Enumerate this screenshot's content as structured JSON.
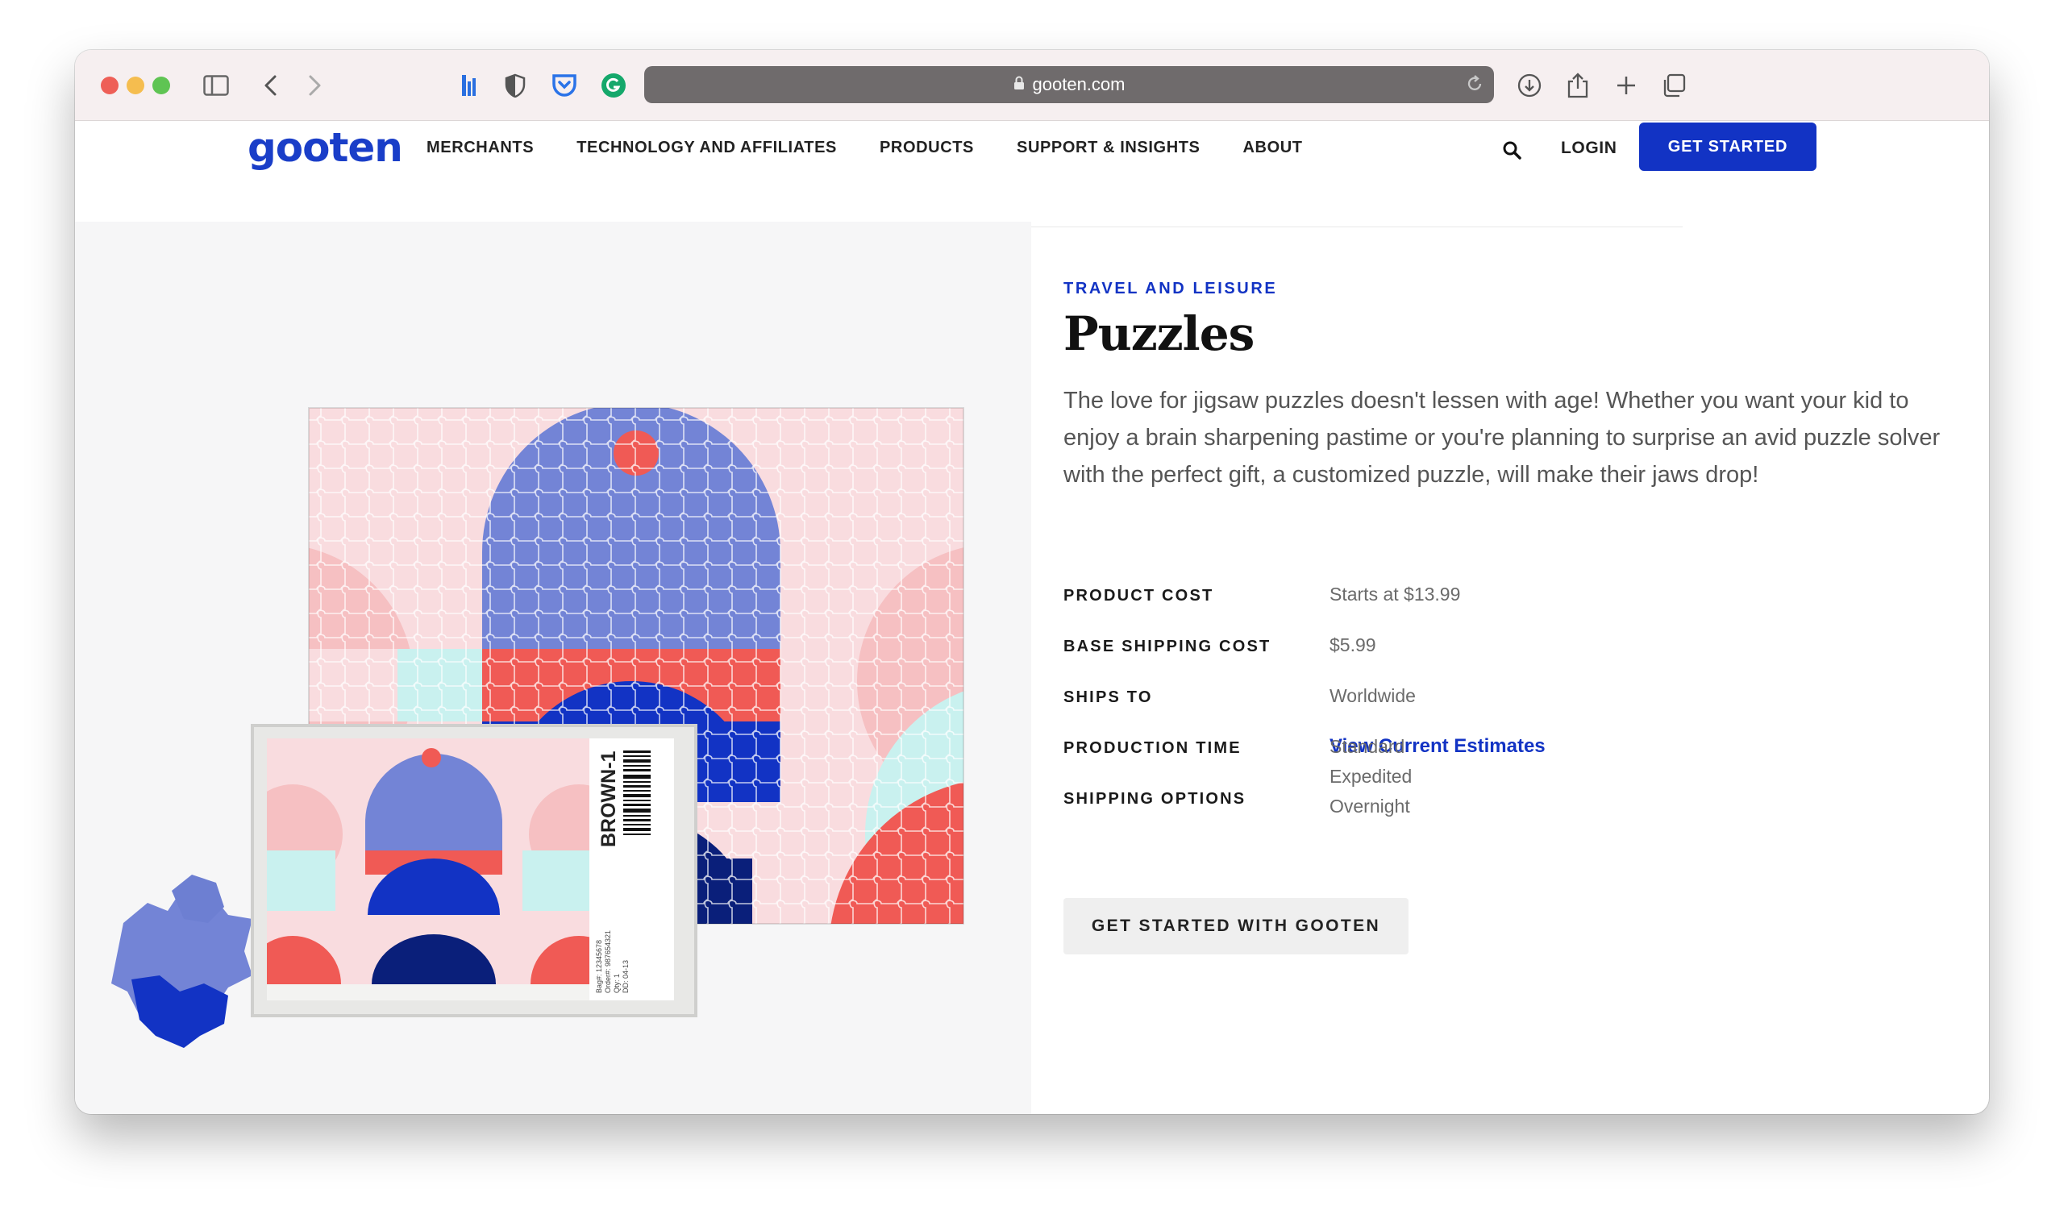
{
  "browser": {
    "url": "gooten.com",
    "icons": [
      "sidebar-icon",
      "back-icon",
      "forward-icon",
      "extension-icon",
      "shield-icon",
      "pocket-icon",
      "grammarly-icon",
      "lock-icon",
      "reload-icon",
      "download-icon",
      "share-icon",
      "new-tab-icon",
      "tabs-overview-icon"
    ]
  },
  "header": {
    "logo": "gooten",
    "nav": [
      "MERCHANTS",
      "TECHNOLOGY AND AFFILIATES",
      "PRODUCTS",
      "SUPPORT & INSIGHTS",
      "ABOUT"
    ],
    "login": "LOGIN",
    "cta": "GET STARTED"
  },
  "product": {
    "category": "TRAVEL AND LEISURE",
    "title": "Puzzles",
    "description": "The love for jigsaw puzzles doesn't lessen with age! Whether you want your kid to enjoy a brain sharpening pastime or you're planning to surprise an avid puzzle solver with the perfect gift, a customized puzzle, will make their jaws drop!",
    "specs": {
      "cost_label": "PRODUCT COST",
      "cost_value": "Starts at $13.99",
      "shipping_label": "BASE SHIPPING COST",
      "shipping_value": "$5.99",
      "ships_to_label": "SHIPS TO",
      "ships_to_value": "Worldwide",
      "production_label": "PRODUCTION TIME",
      "production_link": "View Current Estimates",
      "options_label": "SHIPPING OPTIONS",
      "options": [
        "Standard",
        "Expedited",
        "Overnight"
      ]
    },
    "cta": "GET STARTED WITH GOOTEN",
    "box_label": "BROWN-1",
    "box_small_text": [
      "Bag#: 12345678",
      "Order#: 987654321",
      "Qty: 1",
      "DD: 04-13"
    ]
  },
  "colors": {
    "brand_blue": "#1233c4",
    "chrome_bg": "#f6eff0",
    "puzzle_pink": "#f9dcdf",
    "puzzle_red": "#f05a55",
    "puzzle_periwinkle": "#7384d6",
    "puzzle_navy": "#0a1f7a",
    "puzzle_mint": "#c9f1ef"
  }
}
